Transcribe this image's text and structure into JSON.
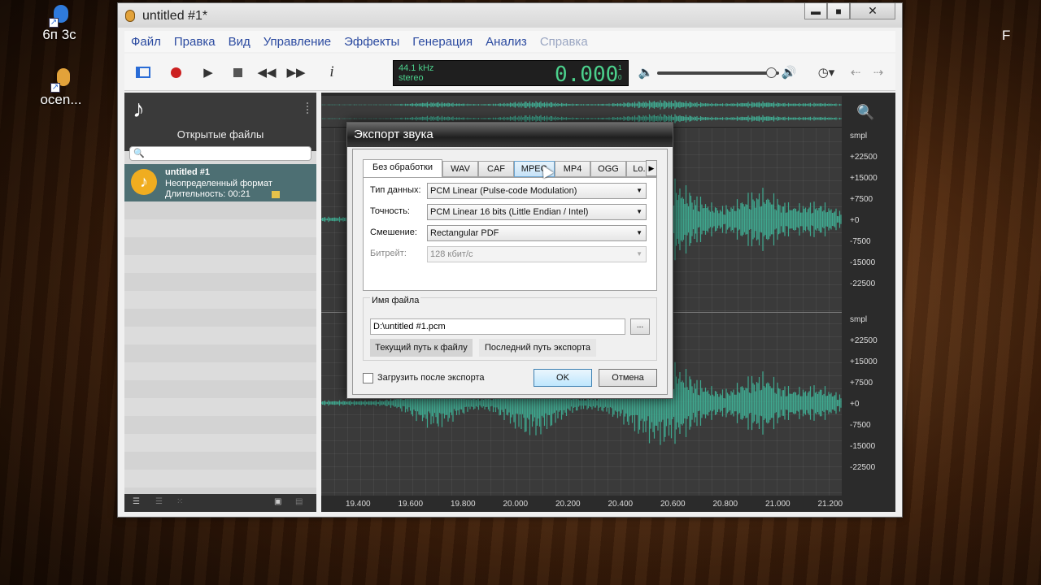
{
  "desktop": {
    "icons": [
      {
        "label": "6п 3с"
      },
      {
        "label": "ocen..."
      }
    ],
    "right_glyph": "F"
  },
  "window": {
    "title": "untitled #1*",
    "min": "▬",
    "max": "■",
    "close": "✕"
  },
  "menu": [
    "Файл",
    "Правка",
    "Вид",
    "Управление",
    "Эффекты",
    "Генерация",
    "Анализ",
    "Справка"
  ],
  "toolbar": {
    "sample_rate": "44.1 kHz",
    "channels": "stereo",
    "time": "0.000",
    "side_top": "1",
    "side_bottom": "0",
    "info": "i",
    "arrow_left": "⇠",
    "arrow_right": "⇢",
    "clock": "◷▾",
    "volume_level": 0.93
  },
  "left_panel": {
    "caption": "Открытые файлы",
    "search_placeholder": "",
    "file": {
      "name": "untitled #1",
      "format": "Неопределенный формат",
      "duration": "Длительность: 00:21"
    }
  },
  "wave": {
    "scale_top": [
      "smpl",
      "+22500",
      "+15000",
      "+7500",
      "+0",
      "-7500",
      "-15000",
      "-22500"
    ],
    "scale_bottom": [
      "smpl",
      "+22500",
      "+15000",
      "+7500",
      "+0",
      "-7500",
      "-15000",
      "-22500"
    ],
    "ruler": [
      "19.400",
      "19.600",
      "19.800",
      "20.000",
      "20.200",
      "20.400",
      "20.600",
      "20.800",
      "21.000",
      "21.200"
    ],
    "wave_color": "#3fa88f"
  },
  "dialog": {
    "title": "Экспорт звука",
    "tabs": [
      "Без обработки",
      "WAV",
      "CAF",
      "MPEG",
      "MP4",
      "OGG",
      "Lo..."
    ],
    "fields": [
      {
        "label": "Тип данных:",
        "value": "PCM Linear (Pulse-code Modulation)",
        "enabled": true
      },
      {
        "label": "Точность:",
        "value": "PCM Linear 16 bits (Little Endian / Intel)",
        "enabled": true
      },
      {
        "label": "Смешение:",
        "value": "Rectangular PDF",
        "enabled": true
      },
      {
        "label": "Битрейт:",
        "value": "128 кбит/с",
        "enabled": false
      }
    ],
    "filename_group": "Имя файла",
    "filename": "D:\\untitled #1.pcm",
    "browse": "...",
    "current_path": "Текущий путь к файлу",
    "last_path": "Последний путь экспорта",
    "load_after": "Загрузить после экспорта",
    "ok": "OK",
    "cancel": "Отмена"
  }
}
